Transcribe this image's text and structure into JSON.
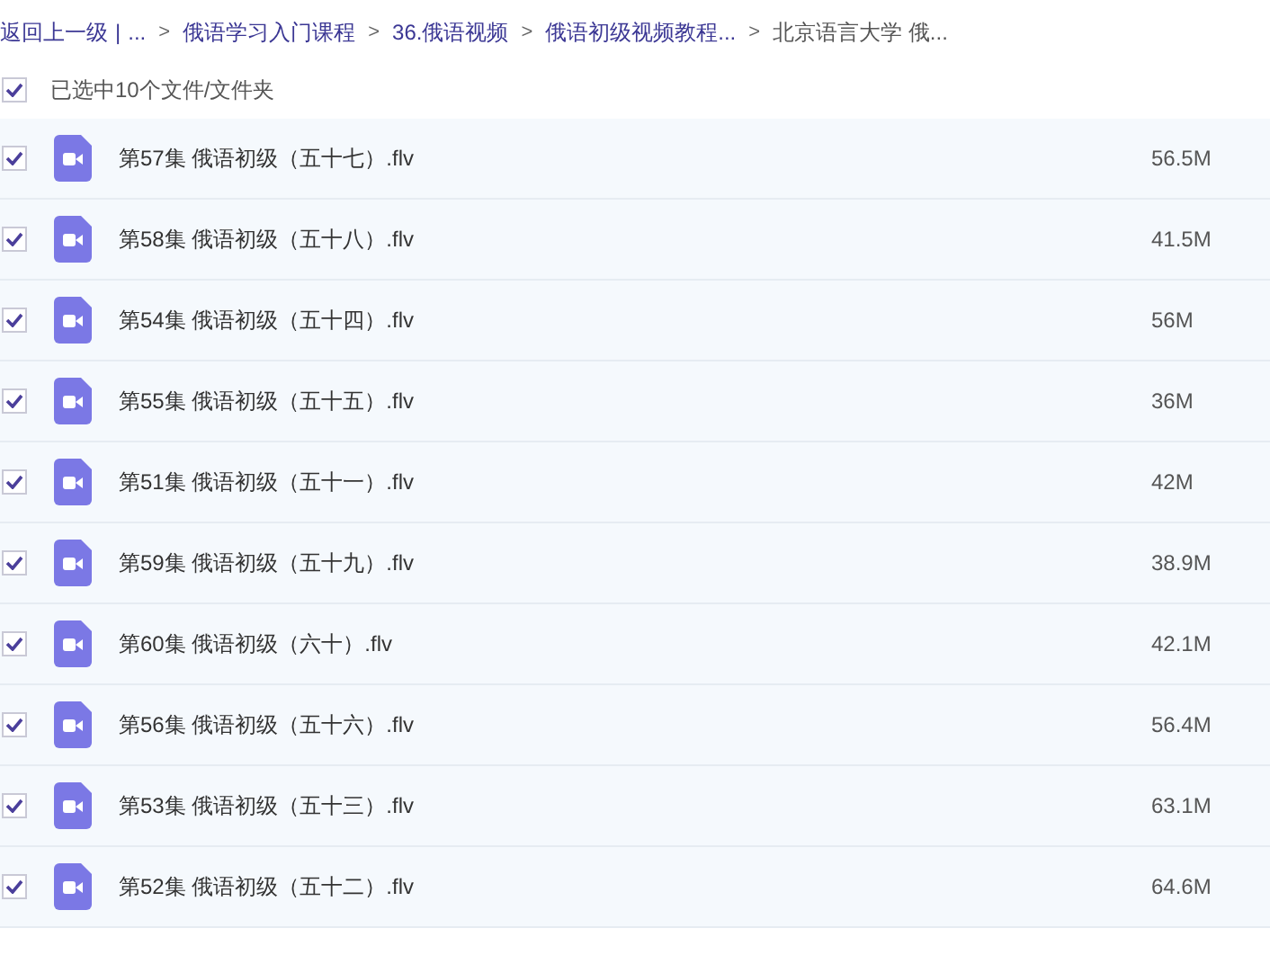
{
  "breadcrumb": {
    "back": "返回上一级",
    "divider": "|",
    "ellipsis": "...",
    "separator": ">",
    "items": [
      {
        "label": "俄语学习入门课程",
        "current": false
      },
      {
        "label": "36.俄语视频",
        "current": false
      },
      {
        "label": "俄语初级视频教程...",
        "current": false
      },
      {
        "label": "北京语言大学 俄...",
        "current": true
      }
    ]
  },
  "selection": {
    "checked": true,
    "label": "已选中10个文件/文件夹"
  },
  "files": [
    {
      "name": "第57集 俄语初级（五十七）.flv",
      "size": "56.5M",
      "checked": true
    },
    {
      "name": "第58集 俄语初级（五十八）.flv",
      "size": "41.5M",
      "checked": true
    },
    {
      "name": "第54集 俄语初级（五十四）.flv",
      "size": "56M",
      "checked": true
    },
    {
      "name": "第55集 俄语初级（五十五）.flv",
      "size": "36M",
      "checked": true
    },
    {
      "name": "第51集 俄语初级（五十一）.flv",
      "size": "42M",
      "checked": true
    },
    {
      "name": "第59集 俄语初级（五十九）.flv",
      "size": "38.9M",
      "checked": true
    },
    {
      "name": "第60集 俄语初级（六十）.flv",
      "size": "42.1M",
      "checked": true
    },
    {
      "name": "第56集 俄语初级（五十六）.flv",
      "size": "56.4M",
      "checked": true
    },
    {
      "name": "第53集 俄语初级（五十三）.flv",
      "size": "63.1M",
      "checked": true
    },
    {
      "name": "第52集 俄语初级（五十二）.flv",
      "size": "64.6M",
      "checked": true
    }
  ]
}
